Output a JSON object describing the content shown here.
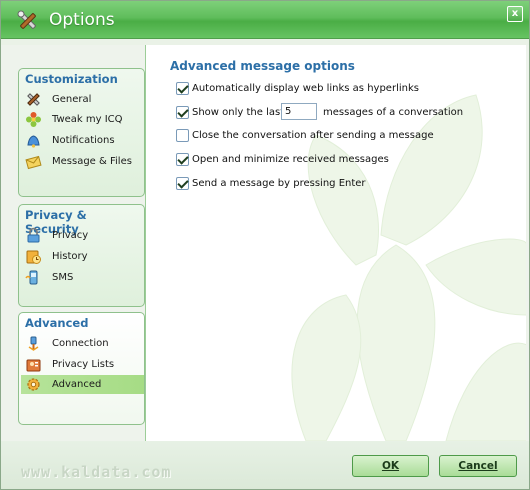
{
  "window": {
    "title": "Options",
    "close_label": "x"
  },
  "sidebar": {
    "groups": [
      {
        "title": "Customization",
        "items": [
          {
            "label": "General",
            "icon": "tools-icon"
          },
          {
            "label": "Tweak my ICQ",
            "icon": "flower-icon"
          },
          {
            "label": "Notifications",
            "icon": "bell-icon"
          },
          {
            "label": "Message & Files",
            "icon": "envelope-icon"
          }
        ]
      },
      {
        "title": "Privacy & Security",
        "items": [
          {
            "label": "Privacy",
            "icon": "lock-icon"
          },
          {
            "label": "History",
            "icon": "history-icon"
          },
          {
            "label": "SMS",
            "icon": "sms-icon"
          }
        ]
      },
      {
        "title": "Advanced",
        "items": [
          {
            "label": "Connection",
            "icon": "plug-icon"
          },
          {
            "label": "Privacy Lists",
            "icon": "contacts-icon"
          },
          {
            "label": "Advanced",
            "icon": "gear-icon",
            "selected": true
          }
        ]
      }
    ]
  },
  "main": {
    "title": "Advanced message options",
    "options": [
      {
        "label": "Automatically display web links as hyperlinks",
        "checked": true
      },
      {
        "label": "Show only the last",
        "checked": true,
        "value": "5",
        "tail": "messages of a conversation"
      },
      {
        "label": "Close the conversation after sending a message",
        "checked": false
      },
      {
        "label": "Open and minimize received messages",
        "checked": true
      },
      {
        "label": "Send a message by pressing Enter",
        "checked": true
      }
    ]
  },
  "footer": {
    "watermark": "www.kaldata.com",
    "ok_label": "OK",
    "cancel_label": "Cancel"
  },
  "colors": {
    "accent_green": "#5fbd5b",
    "heading_blue": "#2c6fa7",
    "selection_green": "#b6e39a"
  }
}
